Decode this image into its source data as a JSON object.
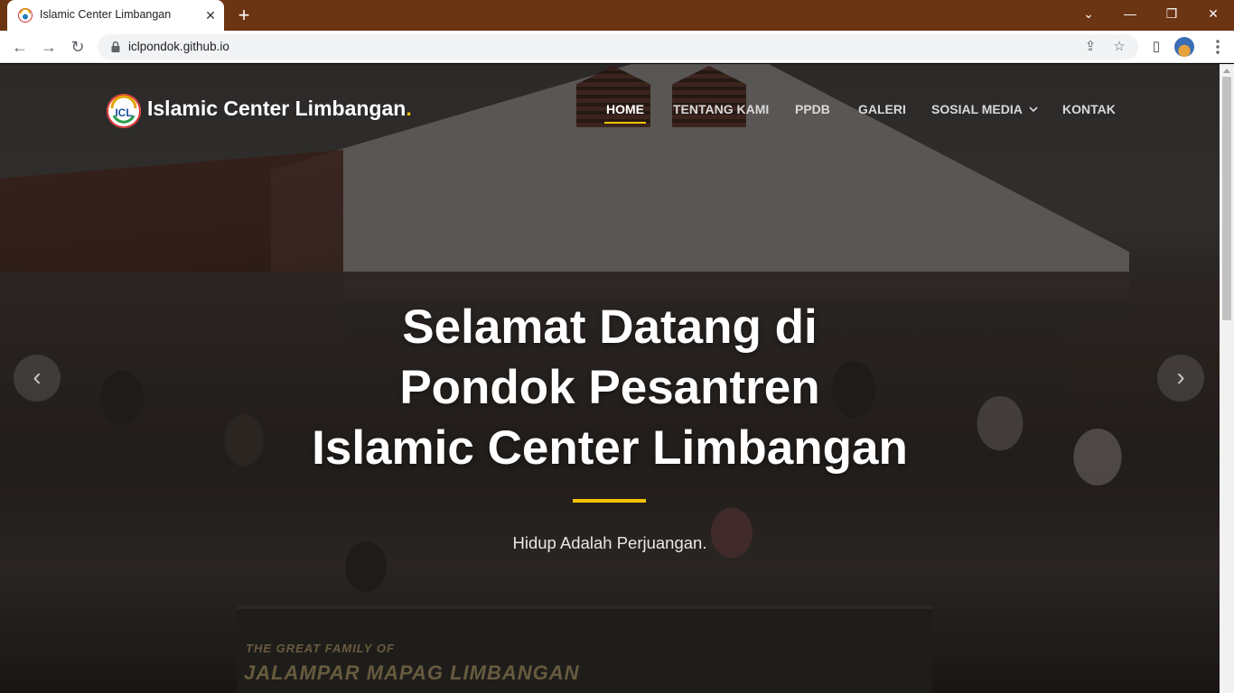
{
  "browser": {
    "tab_title": "Islamic Center Limbangan",
    "tab_close": "✕",
    "new_tab": "+",
    "url": "iclpondok.github.io",
    "window_controls": {
      "minimize": "—",
      "restore": "❐",
      "close": "✕",
      "tab_search": "⌄"
    },
    "nav": {
      "back": "←",
      "forward": "→",
      "reload": "↻"
    },
    "icons": {
      "share": "⇪",
      "star": "☆",
      "sidepanel": "▯"
    }
  },
  "site": {
    "logo_text": "Islamic Center Limbangan",
    "logo_dot": ".",
    "logo_initials": "ICL",
    "menu": {
      "home": "HOME",
      "about": "TENTANG KAMI",
      "ppdb": "PPDB",
      "gallery": "GALERI",
      "social": "SOSIAL MEDIA",
      "contact": "KONTAK"
    },
    "hero": {
      "title_line1": "Selamat Datang di",
      "title_line2": "Pondok Pesantren",
      "title_line3": "Islamic Center Limbangan",
      "subtitle": "Hidup Adalah Perjuangan."
    },
    "banner": {
      "line1": "THE GREAT FAMILY OF",
      "line2": "JALAMPAR MAPAG LIMBANGAN"
    },
    "carousel": {
      "prev": "‹",
      "next": "›"
    }
  },
  "colors": {
    "accent": "#f2c200",
    "tabbar": "#6b3413"
  }
}
